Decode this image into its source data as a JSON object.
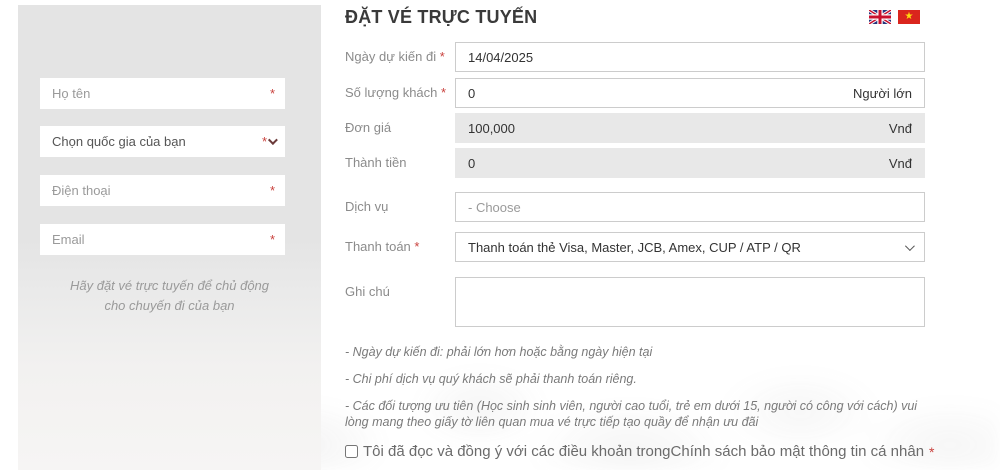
{
  "header": {
    "title": "ĐẶT VÉ TRỰC TUYẾN",
    "flags": [
      {
        "name": "English",
        "icon": "uk-flag-icon"
      },
      {
        "name": "Tiếng Việt",
        "icon": "vietnam-flag-icon",
        "star": "★"
      }
    ]
  },
  "sidebar": {
    "name_placeholder": "Họ tên",
    "country_label": "Chọn quốc gia của bạn",
    "phone_placeholder": "Điện thoại",
    "email_placeholder": "Email",
    "tagline_line1": "Hãy đặt vé trực tuyến để chủ động",
    "tagline_line2": "cho chuyến đi của bạn"
  },
  "form": {
    "required_mark": "*",
    "rows": [
      {
        "label": "Ngày dự kiến đi",
        "required": true,
        "value": "14/04/2025"
      },
      {
        "label": "Số lượng khách",
        "required": true,
        "value": "0",
        "suffix": "Người lớn"
      },
      {
        "label": "Đơn giá",
        "required": false,
        "value": "100,000",
        "suffix": "Vnđ",
        "disabled": true
      },
      {
        "label": "Thành tiền",
        "required": false,
        "value": "0",
        "suffix": "Vnđ",
        "disabled": true
      },
      {
        "label": "Dịch vụ",
        "required": false,
        "placeholder": "- Choose"
      },
      {
        "label": "Thanh toán",
        "required": true,
        "value": "Thanh toán thẻ Visa, Master, JCB, Amex, CUP / ATP / QR"
      },
      {
        "label": "Ghi chú",
        "required": false,
        "value": ""
      }
    ],
    "notes": [
      "- Ngày dự kiến đi: phải lớn hơn hoặc bằng ngày hiện tại",
      "- Chi phí dịch vụ quý khách sẽ phải thanh toán riêng.",
      "- Các đối tượng ưu tiên (Học sinh sinh viên, người cao tuổi, trẻ em dưới 15, người có công với cách) vui lòng mang theo giấy tờ liên quan mua vé trực tiếp tạo quầy để nhận ưu đãi"
    ],
    "consent": {
      "text_before_link": "Tôi đã đọc và đồng ý với các điều khoản trong ",
      "link_text": "Chính sách bảo mật thông tin cá nhân",
      "checked": false
    }
  },
  "colors": {
    "required": "#c9413d",
    "sidebar_bg": "#e4e4e4",
    "disabled_bg": "#e8e8e8",
    "flag_red": "#da251d",
    "flag_star_yellow": "#ffd90f"
  }
}
